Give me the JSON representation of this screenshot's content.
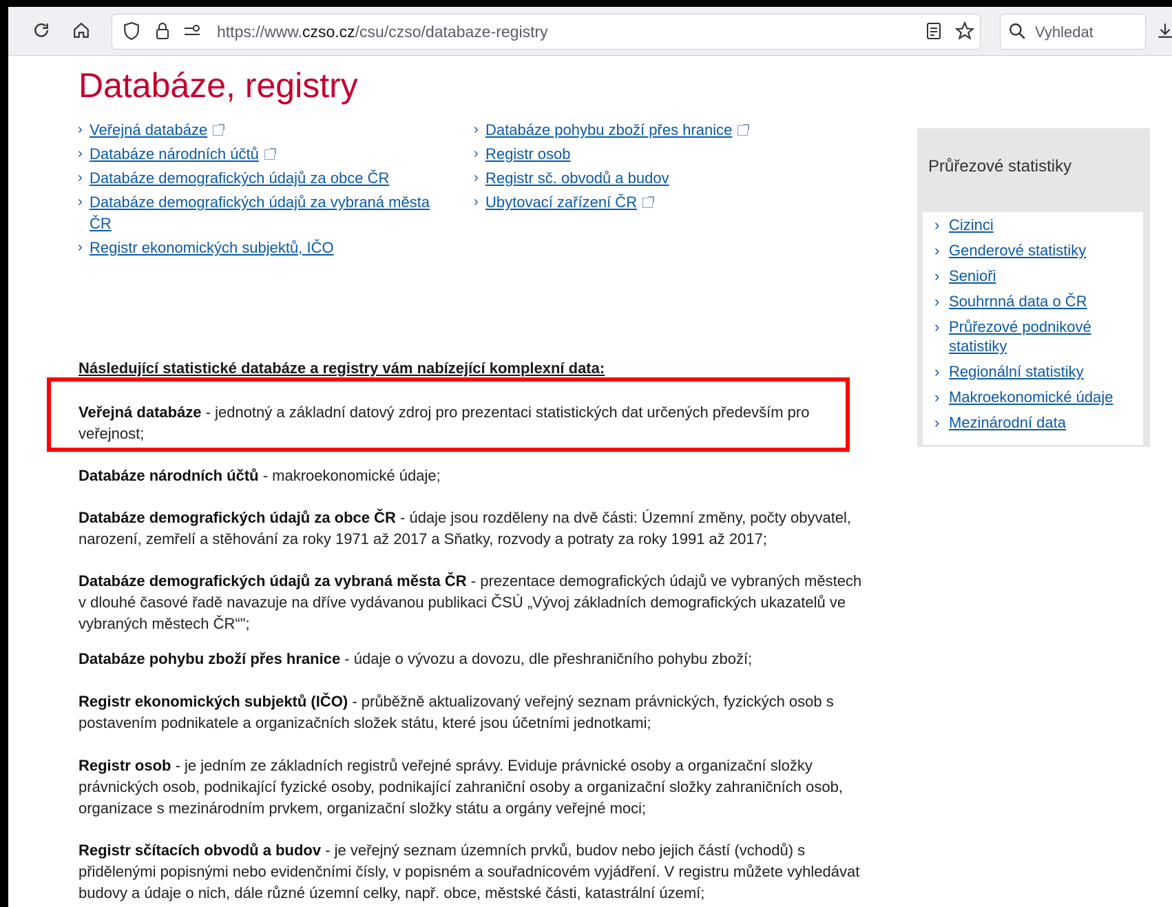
{
  "browser": {
    "url_prefix": "https://www.",
    "url_domain": "czso.cz",
    "url_path": "/csu/czso/databaze-registry",
    "search_placeholder": "Vyhledat"
  },
  "page": {
    "title": "Databáze, registry",
    "links_left": [
      {
        "label": "Veřejná databáze",
        "external": true
      },
      {
        "label": "Databáze národních účtů",
        "external": true
      },
      {
        "label": "Databáze demografických údajů za obce ČR",
        "external": false
      },
      {
        "label": "Databáze demografických údajů za vybraná města ČR",
        "external": false
      },
      {
        "label": "Registr ekonomických subjektů, IČO",
        "external": false
      }
    ],
    "links_right": [
      {
        "label": "Databáze pohybu zboží přes hranice",
        "external": true
      },
      {
        "label": "Registr osob",
        "external": false
      },
      {
        "label": "Registr sč. obvodů a budov",
        "external": false
      },
      {
        "label": "Ubytovací zařízení ČR",
        "external": true
      }
    ],
    "intro": "Následující statistické databáze a registry vám nabízející komplexní data:",
    "descriptions": [
      {
        "term": "Veřejná databáze",
        "text": " - jednotný a základní datový zdroj pro prezentaci statistických dat určených především pro veřejnost;"
      },
      {
        "term": "Databáze národních účtů",
        "text": " - makroekonomické údaje;"
      },
      {
        "term": "Databáze demografických údajů za obce ČR",
        "text": " - údaje jsou rozděleny na dvě části: Územní změny, počty obyvatel, narození, zemřelí a stěhování za roky 1971 až 2017 a Sňatky, rozvody a potraty za roky 1991 až 2017;"
      },
      {
        "term": "Databáze demografických údajů za vybraná města ČR",
        "text": " - prezentace demografických údajů ve vybraných městech v dlouhé časové řadě navazuje na dříve vydávanou publikaci ČSÚ „Vývoj základních demografických ukazatelů ve vybraných městech ČR“\";"
      },
      {
        "term": "Databáze pohybu zboží přes hranice",
        "text": " - údaje o vývozu a dovozu, dle přeshraničního pohybu zboží;"
      },
      {
        "term": "Registr ekonomických subjektů (IČO)",
        "text": " - průběžně aktualizovaný veřejný seznam právnických, fyzických osob s postavením podnikatele a organizačních složek státu, které jsou účetními jednotkami;"
      },
      {
        "term": "Registr osob",
        "text": " - je jedním ze základních registrů veřejné správy. Eviduje právnické osoby a organizační složky právnických osob, podnikající fyzické osoby, podnikající zahraniční osoby a organizační složky zahraničních osob, organizace s mezinárodním prvkem, organizační složky státu a orgány veřejné moci;"
      },
      {
        "term": "Registr sčítacích obvodů a budov",
        "text": " - je veřejný seznam územních prvků, budov nebo jejich částí (vchodů) s přidělenými popisnými nebo evidenčními čísly, v popisném a souřadnicovém vyjádření. V registru můžete vyhledávat budovy a údaje o nich, dále různé územní celky, např. obce, městské části, katastrální území;"
      }
    ]
  },
  "sidebar": {
    "title": "Průřezové statistiky",
    "items": [
      "Cizinci",
      "Genderové statistiky",
      "Senioři",
      "Souhrnná data o ČR",
      "Průřezové podnikové statistiky",
      "Regionální statistiky",
      "Makroekonomické údaje",
      "Mezinárodní data"
    ]
  },
  "colors": {
    "title": "#c5002f",
    "link": "#0b5aa8",
    "highlight": "#ff0000"
  }
}
